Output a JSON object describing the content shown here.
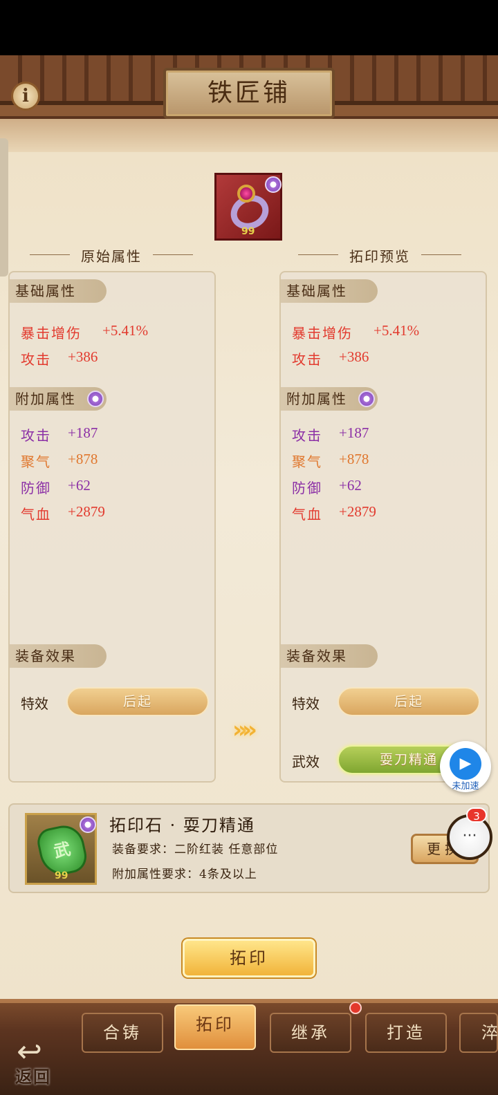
{
  "header": {
    "title": "铁匠铺",
    "info_icon": "i"
  },
  "item": {
    "level": "99"
  },
  "left_panel": {
    "section_title": "原始属性",
    "base_tag": "基础属性",
    "base_stats": [
      {
        "name": "暴击增伤",
        "value": "+5.41%"
      },
      {
        "name": "攻击",
        "value": "+386"
      }
    ],
    "extra_tag": "附加属性",
    "extra_stats": [
      {
        "name": "攻击",
        "value": "+187"
      },
      {
        "name": "聚气",
        "value": "+878"
      },
      {
        "name": "防御",
        "value": "+62"
      },
      {
        "name": "气血",
        "value": "+2879"
      }
    ],
    "effect_tag": "装备效果",
    "effects": [
      {
        "label": "特效",
        "value": "后起"
      }
    ]
  },
  "right_panel": {
    "section_title": "拓印预览",
    "base_tag": "基础属性",
    "base_stats": [
      {
        "name": "暴击增伤",
        "value": "+5.41%"
      },
      {
        "name": "攻击",
        "value": "+386"
      }
    ],
    "extra_tag": "附加属性",
    "extra_stats": [
      {
        "name": "攻击",
        "value": "+187"
      },
      {
        "name": "聚气",
        "value": "+878"
      },
      {
        "name": "防御",
        "value": "+62"
      },
      {
        "name": "气血",
        "value": "+2879"
      }
    ],
    "effect_tag": "装备效果",
    "effects": [
      {
        "label": "特效",
        "value": "后起"
      },
      {
        "label": "武效",
        "value": "耍刀精通"
      }
    ]
  },
  "arrows": "»",
  "stone": {
    "name": "拓印石 · 耍刀精通",
    "icon_char": "武",
    "level": "99",
    "requirement_equip": "装备要求：二阶红装  任意部位",
    "requirement_extra": "附加属性要求：4条及以上",
    "change_label": "更换"
  },
  "main_button": "拓印",
  "tabs": [
    {
      "label": "合铸"
    },
    {
      "label": "拓印"
    },
    {
      "label": "继承"
    },
    {
      "label": "打造"
    },
    {
      "label": "淬"
    }
  ],
  "back_label": "返回",
  "float_widget": {
    "label": "未加速"
  },
  "chat": {
    "badge": "3",
    "icon": "···"
  },
  "colors": {
    "red": "#e23a2e",
    "purple": "#8b2fa6",
    "orange": "#e0772e"
  }
}
